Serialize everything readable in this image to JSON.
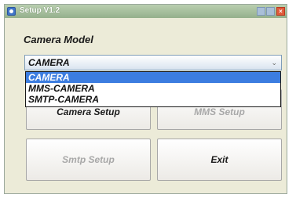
{
  "window": {
    "title": "Setup  V1.2"
  },
  "camera_model": {
    "label": "Camera Model",
    "selected": "CAMERA",
    "options": [
      "CAMERA",
      "MMS-CAMERA",
      "SMTP-CAMERA"
    ]
  },
  "buttons": {
    "camera_setup": "Camera Setup",
    "mms_setup": "MMS Setup",
    "smtp_setup": "Smtp Setup",
    "exit": "Exit"
  },
  "icons": {
    "title_bar": [
      "app-icon",
      "minimize-icon",
      "maximize-icon",
      "close-icon"
    ],
    "select_arrow": "chevron-down-icon"
  },
  "colors": {
    "selection_highlight": "#3c7de0",
    "titlebar": "#a8c09e",
    "disabled_text": "#a8a8a8"
  }
}
